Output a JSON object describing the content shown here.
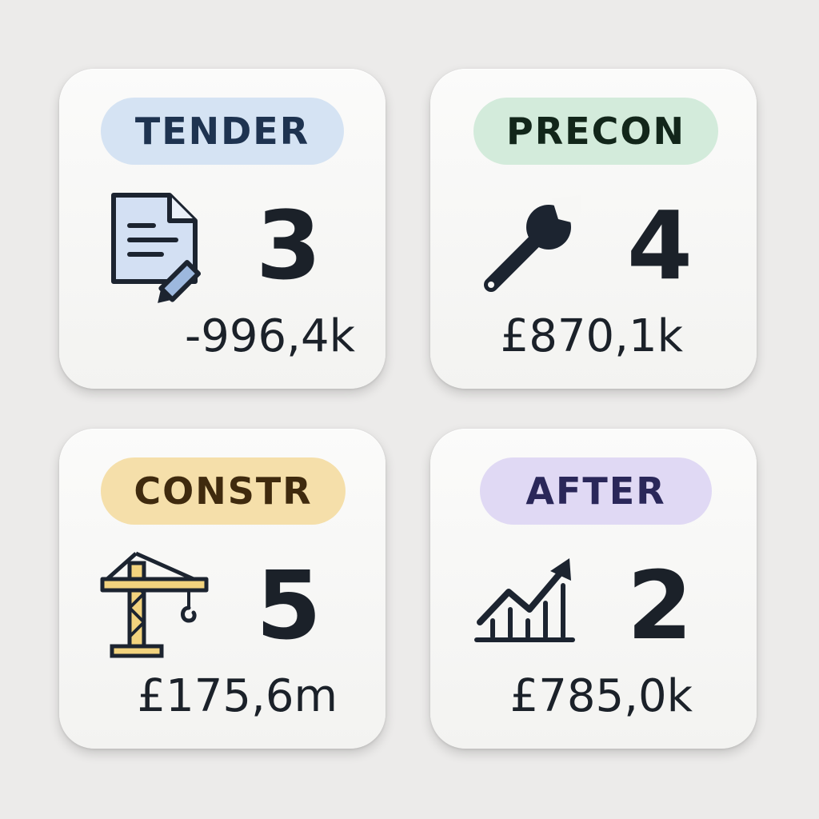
{
  "cards": [
    {
      "id": "tender",
      "label": "TENDER",
      "count": "3",
      "amount": "-996,4k",
      "icon": "document-edit-icon",
      "pill_bg": "#d5e3f3",
      "pill_text": "#1e3350"
    },
    {
      "id": "precon",
      "label": "PRECON",
      "count": "4",
      "amount": "£870,1k",
      "icon": "wrench-icon",
      "pill_bg": "#d3ebdb",
      "pill_text": "#12261a"
    },
    {
      "id": "constr",
      "label": "CONSTR",
      "count": "5",
      "amount": "£175,6m",
      "icon": "crane-icon",
      "pill_bg": "#f5dfaa",
      "pill_text": "#3f2a0e"
    },
    {
      "id": "after",
      "label": "AFTER",
      "count": "2",
      "amount": "£785,0k",
      "icon": "growth-chart-icon",
      "pill_bg": "#e0d9f4",
      "pill_text": "#2a2759"
    }
  ]
}
